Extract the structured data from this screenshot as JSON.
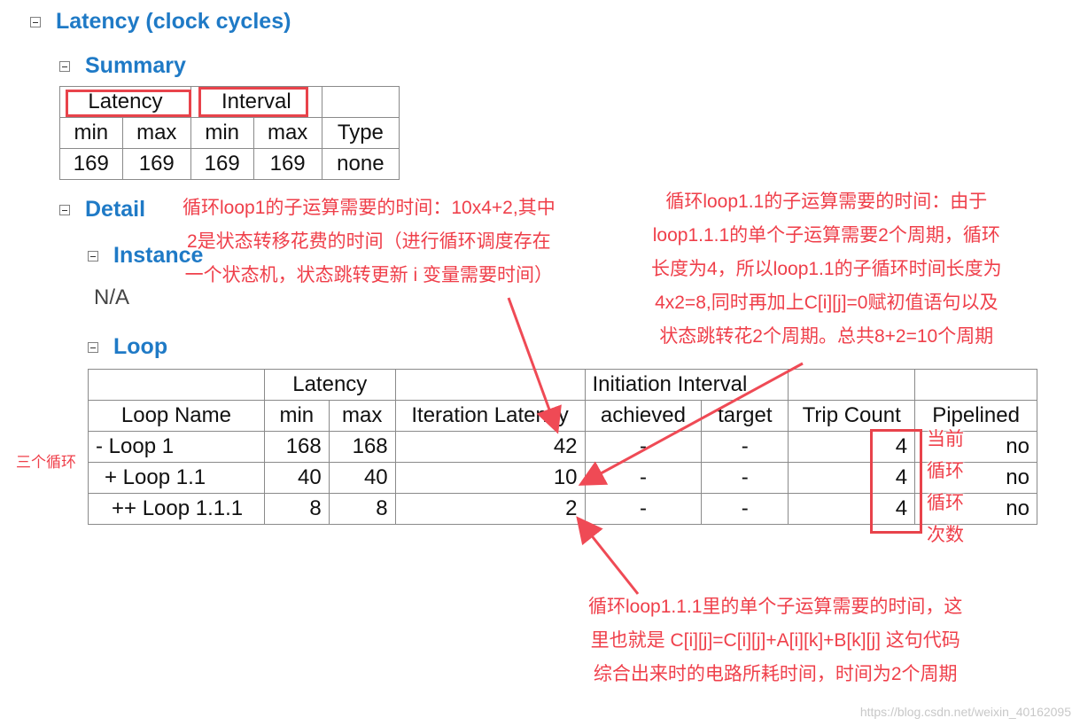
{
  "sections": {
    "latency_title": "Latency (clock cycles)",
    "summary_title": "Summary",
    "detail_title": "Detail",
    "instance_title": "Instance",
    "instance_value": "N/A",
    "loop_title": "Loop"
  },
  "summary_table": {
    "group_headers": [
      "Latency",
      "Interval",
      ""
    ],
    "columns": [
      "min",
      "max",
      "min",
      "max",
      "Type"
    ],
    "row": [
      "169",
      "169",
      "169",
      "169",
      "none"
    ]
  },
  "loop_table": {
    "group_headers": [
      "",
      "Latency",
      "",
      "Initiation Interval",
      "",
      ""
    ],
    "columns": [
      "Loop Name",
      "min",
      "max",
      "Iteration Latency",
      "achieved",
      "target",
      "Trip Count",
      "Pipelined"
    ],
    "rows": [
      [
        "- Loop 1",
        "168",
        "168",
        "42",
        "-",
        "-",
        "4",
        "no"
      ],
      [
        "+ Loop 1.1",
        "40",
        "40",
        "10",
        "-",
        "-",
        "4",
        "no"
      ],
      [
        "++ Loop 1.1.1",
        "8",
        "8",
        "2",
        "-",
        "-",
        "4",
        "no"
      ]
    ]
  },
  "annotations": {
    "loop1": [
      "循环loop1的子运算需要的时间：10x4+2,其中",
      "2是状态转移花费的时间（进行循环调度存在",
      "一个状态机，状态跳转更新 i 变量需要时间）"
    ],
    "loop11": [
      "循环loop1.1的子运算需要的时间：由于",
      "loop1.1.1的单个子运算需要2个周期，循环",
      "长度为4，所以loop1.1的子循环时间长度为",
      "4x2=8,同时再加上C[i][j]=0赋初值语句以及",
      "状态跳转花2个周期。总共8+2=10个周期"
    ],
    "loop111": [
      "循环loop1.1.1里的单个子运算需要的时间，这",
      "里也就是 C[i][j]=C[i][j]+A[i][k]+B[k][j] 这句代码",
      "综合出来时的电路所耗时间，时间为2个周期"
    ],
    "trip": [
      "当前",
      "循环",
      "循环",
      "次数"
    ],
    "three_loops": "三个循环"
  },
  "watermark": "https://blog.csdn.net/weixin_40162095",
  "colors": {
    "heading": "#1f7ac6",
    "annotation": "#ef3f4a"
  }
}
